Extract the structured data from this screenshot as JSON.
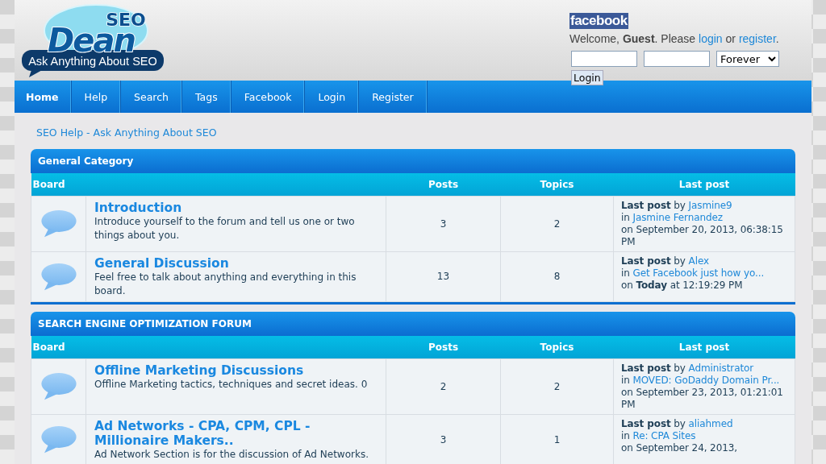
{
  "logo": {
    "title_small": "SEO",
    "title": "Dean",
    "tagline": "Ask Anything About SEO"
  },
  "user_panel": {
    "facebook": "facebook",
    "welcome": "Welcome, **Guest**. Please",
    "login_link": "login",
    "middle": "or",
    "register_link": "register",
    "end": ".",
    "remember": "Forever",
    "login_button": "Login"
  },
  "nav": [
    {
      "label": "Home",
      "selected": true
    },
    {
      "label": "Help",
      "selected": false
    },
    {
      "label": "Search",
      "selected": false
    },
    {
      "label": "Tags",
      "selected": false
    },
    {
      "label": "Facebook",
      "selected": false
    },
    {
      "label": "Login",
      "selected": false
    },
    {
      "label": "Register",
      "selected": false
    }
  ],
  "breadcrumb": "SEO Help - Ask Anything About SEO",
  "categories": [
    {
      "title": "General Category",
      "columns": [
        "Board",
        "Posts",
        "Topics",
        "Last post"
      ],
      "boards": [
        {
          "name": "Introduction",
          "description": "Introduce yourself to the forum and tell us one or two things about you.",
          "posts": "3",
          "topics": "2",
          "last_post": {
            "label": "**Last post** by",
            "author": "Jasmine9",
            "in": "in",
            "topic": "Jasmine Fernandez",
            "date": "on September 20, 2013, 06:38:15 PM"
          }
        },
        {
          "name": "General Discussion",
          "description": "Feel free to talk about anything and everything in this board.",
          "posts": "13",
          "topics": "8",
          "last_post": {
            "label": "**Last post** by",
            "author": "Alex",
            "in": "in",
            "topic": "Get Facebook just how yo...",
            "date": "on **Today** at 12:19:29 PM"
          }
        }
      ]
    },
    {
      "title": "SEARCH ENGINE OPTIMIZATION FORUM",
      "columns": [
        "Board",
        "Posts",
        "Topics",
        "Last post"
      ],
      "boards": [
        {
          "name": "Offline Marketing Discussions",
          "description": "Offline Marketing tactics, techniques and secret ideas. 0",
          "posts": "2",
          "topics": "2",
          "last_post": {
            "label": "**Last post** by",
            "author": "Administrator",
            "in": "in",
            "topic": "MOVED: GoDaddy Domain Pr...",
            "date": "on September 23, 2013, 01:21:01 PM"
          }
        },
        {
          "name": "Ad Networks - CPA, CPM, CPL - Millionaire Makers..",
          "description": "Ad Network Section is for the discussion of Ad Networks.",
          "posts": "3",
          "topics": "1",
          "last_post": {
            "label": "**Last post** by",
            "author": "aliahmed",
            "in": "in",
            "topic": "Re: CPA Sites",
            "date": "on September 24, 2013,"
          }
        }
      ]
    }
  ]
}
